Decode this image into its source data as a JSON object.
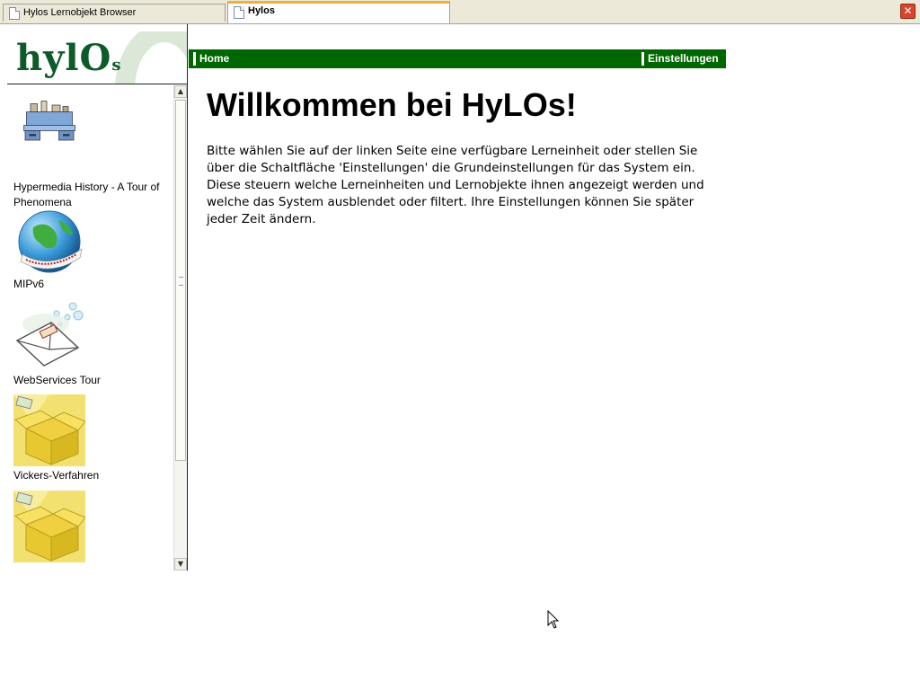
{
  "tabs": [
    {
      "label": "Hylos Lernobjekt Browser",
      "active": false
    },
    {
      "label": "Hylos",
      "active": true
    }
  ],
  "logo": {
    "text_main": "hylO",
    "text_small": "s"
  },
  "sidebar": {
    "items": [
      {
        "label": "Hypermedia History - A Tour of Phenomena",
        "icon": "desk-icon"
      },
      {
        "label": "MIPv6",
        "icon": "globe-icon"
      },
      {
        "label": "WebServices Tour",
        "icon": "envelope-icon"
      },
      {
        "label": "Vickers-Verfahren",
        "icon": "box-icon"
      },
      {
        "label": "",
        "icon": "box-icon"
      }
    ]
  },
  "nav": {
    "home": "Home",
    "settings": "Einstellungen"
  },
  "main": {
    "title": "Willkommen bei HyLOs!",
    "intro": "Bitte wählen Sie auf der linken Seite eine verfügbare Lerneinheit oder stellen Sie über die Schaltfläche 'Einstellungen' die Grundeinstellungen für das System ein. Diese steuern welche Lerneinheiten und Lernobjekte ihnen angezeigt werden und welche das System ausblendet oder filtert. Ihre Einstellungen können Sie später jeder Zeit ändern."
  },
  "colors": {
    "nav_green": "#006600",
    "logo_green": "#0d5a2a"
  }
}
